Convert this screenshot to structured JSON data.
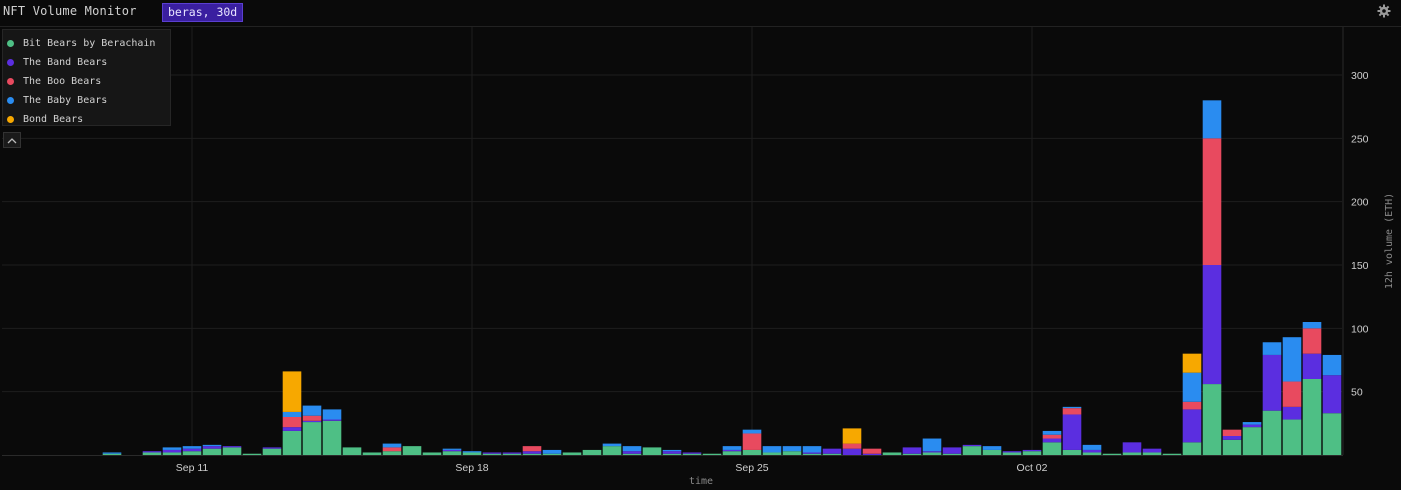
{
  "header": {
    "title": "NFT Volume Monitor",
    "query": "beras, 30d"
  },
  "icons": {
    "settings": "gear-icon",
    "collapse": "chevron-up-icon"
  },
  "chart_data": {
    "type": "bar",
    "stacked": true,
    "xlabel": "time",
    "ylabel": "12h volume (ETH)",
    "ylim": [
      0,
      335
    ],
    "yticks": [
      50,
      100,
      150,
      200,
      250,
      300
    ],
    "xticks": [
      {
        "label": "Sep 11",
        "index": 9
      },
      {
        "label": "Sep 18",
        "index": 23
      },
      {
        "label": "Sep 25",
        "index": 37
      },
      {
        "label": "Oct 02",
        "index": 51
      }
    ],
    "grid": true,
    "legend_position": "top-left",
    "series": [
      {
        "name": "Bit Bears by Berachain",
        "color": "#4ebf85",
        "values": [
          0,
          0,
          0,
          0,
          0,
          1,
          0,
          2,
          2,
          3,
          5,
          6,
          1,
          5,
          19,
          26,
          27,
          6,
          2,
          3,
          7,
          2,
          3,
          2,
          1,
          1,
          1,
          1,
          2,
          4,
          7,
          1,
          6,
          1,
          1,
          1,
          3,
          4,
          2,
          3,
          1,
          1,
          0,
          0,
          2,
          1,
          2,
          1,
          7,
          4,
          2,
          3,
          10,
          4,
          2,
          1,
          2,
          2,
          1,
          10,
          56,
          12,
          22,
          35,
          28,
          60,
          33
        ]
      },
      {
        "name": "The Band Bears",
        "color": "#5b2ee0",
        "values": [
          0,
          0,
          0,
          0,
          0,
          0,
          0,
          1,
          2,
          2,
          2,
          1,
          0,
          1,
          3,
          1,
          1,
          0,
          0,
          0,
          0,
          0,
          1,
          0,
          1,
          1,
          2,
          0,
          0,
          0,
          0,
          2,
          0,
          2,
          1,
          0,
          1,
          0,
          0,
          0,
          1,
          4,
          5,
          1,
          0,
          5,
          1,
          5,
          1,
          0,
          1,
          1,
          3,
          28,
          2,
          0,
          8,
          3,
          0,
          26,
          94,
          3,
          2,
          44,
          10,
          20,
          30
        ]
      },
      {
        "name": "The Boo Bears",
        "color": "#e84a5f",
        "values": [
          0,
          0,
          0,
          0,
          0,
          0,
          0,
          0,
          0,
          0,
          0,
          0,
          0,
          0,
          8,
          4,
          0,
          0,
          0,
          3,
          0,
          0,
          0,
          0,
          0,
          0,
          4,
          0,
          0,
          0,
          0,
          0,
          0,
          0,
          0,
          0,
          0,
          13,
          0,
          0,
          0,
          0,
          4,
          4,
          0,
          0,
          0,
          0,
          0,
          0,
          0,
          0,
          3,
          5,
          0,
          0,
          0,
          0,
          0,
          6,
          100,
          5,
          0,
          0,
          20,
          20,
          0
        ]
      },
      {
        "name": "The Baby Bears",
        "color": "#2a8cf0",
        "values": [
          0,
          0,
          0,
          0,
          0,
          1,
          0,
          0,
          2,
          2,
          1,
          0,
          0,
          0,
          4,
          8,
          8,
          0,
          0,
          3,
          0,
          0,
          1,
          1,
          0,
          0,
          0,
          3,
          0,
          0,
          2,
          4,
          0,
          1,
          0,
          0,
          3,
          3,
          5,
          4,
          5,
          0,
          0,
          0,
          0,
          0,
          10,
          0,
          0,
          3,
          0,
          0,
          3,
          1,
          4,
          0,
          0,
          0,
          0,
          23,
          30,
          0,
          2,
          10,
          35,
          5,
          16
        ]
      },
      {
        "name": "Bond Bears",
        "color": "#f7a800",
        "values": [
          0,
          0,
          0,
          0,
          0,
          0,
          0,
          0,
          0,
          0,
          0,
          0,
          0,
          0,
          32,
          0,
          0,
          0,
          0,
          0,
          0,
          0,
          0,
          0,
          0,
          0,
          0,
          0,
          0,
          0,
          0,
          0,
          0,
          0,
          0,
          0,
          0,
          0,
          0,
          0,
          0,
          0,
          12,
          0,
          0,
          0,
          0,
          0,
          0,
          0,
          0,
          0,
          0,
          0,
          0,
          0,
          0,
          0,
          0,
          15,
          0,
          0,
          0,
          0,
          0,
          0,
          0
        ]
      }
    ]
  }
}
